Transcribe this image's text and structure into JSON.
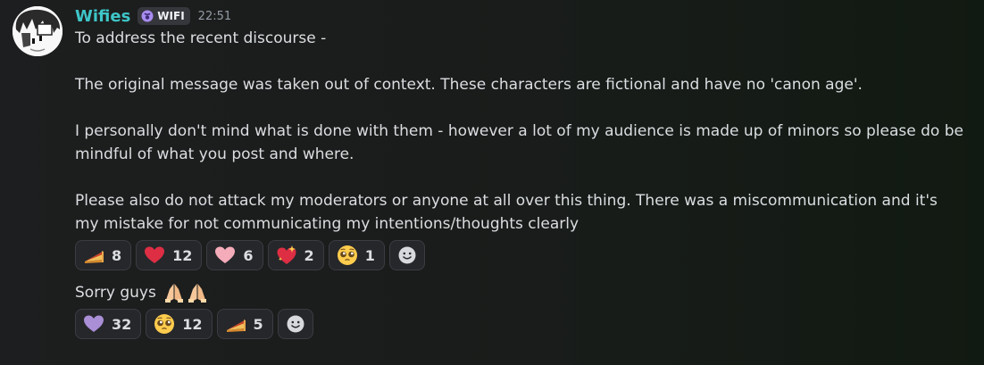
{
  "message": {
    "username": "Wifies",
    "tag": {
      "label": "WIFI",
      "icon": "purple-moon-badge-icon"
    },
    "timestamp": "22:51",
    "lines": [
      "To address the recent discourse -",
      "",
      "The original message was taken out of context. These characters are fictional and have no 'canon age'.",
      "",
      "I personally don't mind what is done with them - however a lot of my audience is made up of minors so please do be",
      "mindful of what you post and where.",
      "",
      "Please also do not attack my moderators or anyone at all over this thing. There was a miscommunication and it's",
      "my mistake for not communicating my intentions/thoughts clearly"
    ],
    "reactions": [
      {
        "emoji": "pie-slice-emoji",
        "count": "8"
      },
      {
        "emoji": "red-heart-emoji",
        "count": "12"
      },
      {
        "emoji": "pink-heart-emoji",
        "count": "6"
      },
      {
        "emoji": "sparkling-heart-emoji",
        "count": "2"
      },
      {
        "emoji": "pleading-face-emoji",
        "count": "1"
      }
    ],
    "add_reaction_icon": "add-reaction-smiley-icon"
  },
  "followup": {
    "text": "Sorry guys",
    "emojis": [
      "folded-hands-emoji",
      "folded-hands-emoji"
    ],
    "reactions": [
      {
        "emoji": "purple-heart-emoji",
        "count": "32"
      },
      {
        "emoji": "pleading-face-emoji",
        "count": "12"
      },
      {
        "emoji": "pie-slice-emoji",
        "count": "5"
      }
    ],
    "add_reaction_icon": "add-reaction-smiley-icon"
  },
  "colors": {
    "username": "#3ec6c8",
    "text": "#dbdee1",
    "timestamp": "#949ba4",
    "reaction_bg": "#26272b",
    "reaction_border": "#3a3c42"
  }
}
